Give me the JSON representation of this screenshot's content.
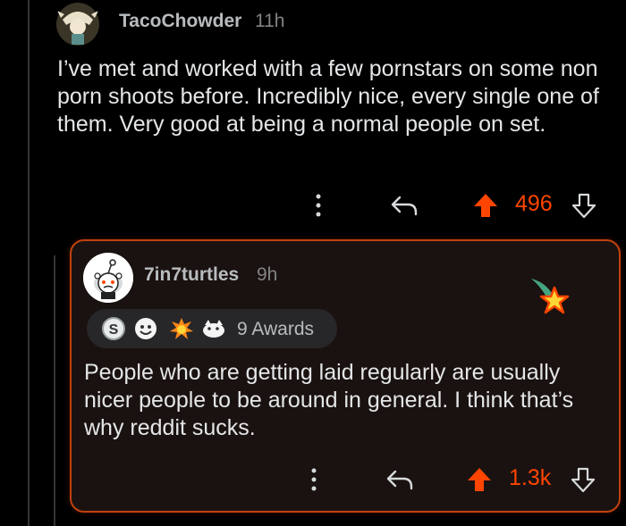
{
  "comment": {
    "author": "TacoChowder",
    "time": "11h",
    "body": "I’ve met and worked with a few pornstars on some non porn shoots before. Incredibly nice, every single one of them. Very good at being a normal people on set.",
    "score": "496",
    "icons": [
      "more-options-icon",
      "reply-icon",
      "upvote-icon",
      "downvote-icon"
    ]
  },
  "reply": {
    "author": "7in7turtles",
    "time": "9h",
    "awards_label": "9 Awards",
    "body": "People who are getting laid regularly are usually nicer people to be around in general. I think that’s why reddit sucks.",
    "score": "1.3k",
    "icons": [
      "more-options-icon",
      "reply-icon",
      "upvote-icon",
      "downvote-icon"
    ]
  },
  "colors": {
    "accent": "#ff4500",
    "background": "#000000",
    "text": "#e4e6e8",
    "muted": "#818384",
    "highlight_border": "#c0420f"
  }
}
